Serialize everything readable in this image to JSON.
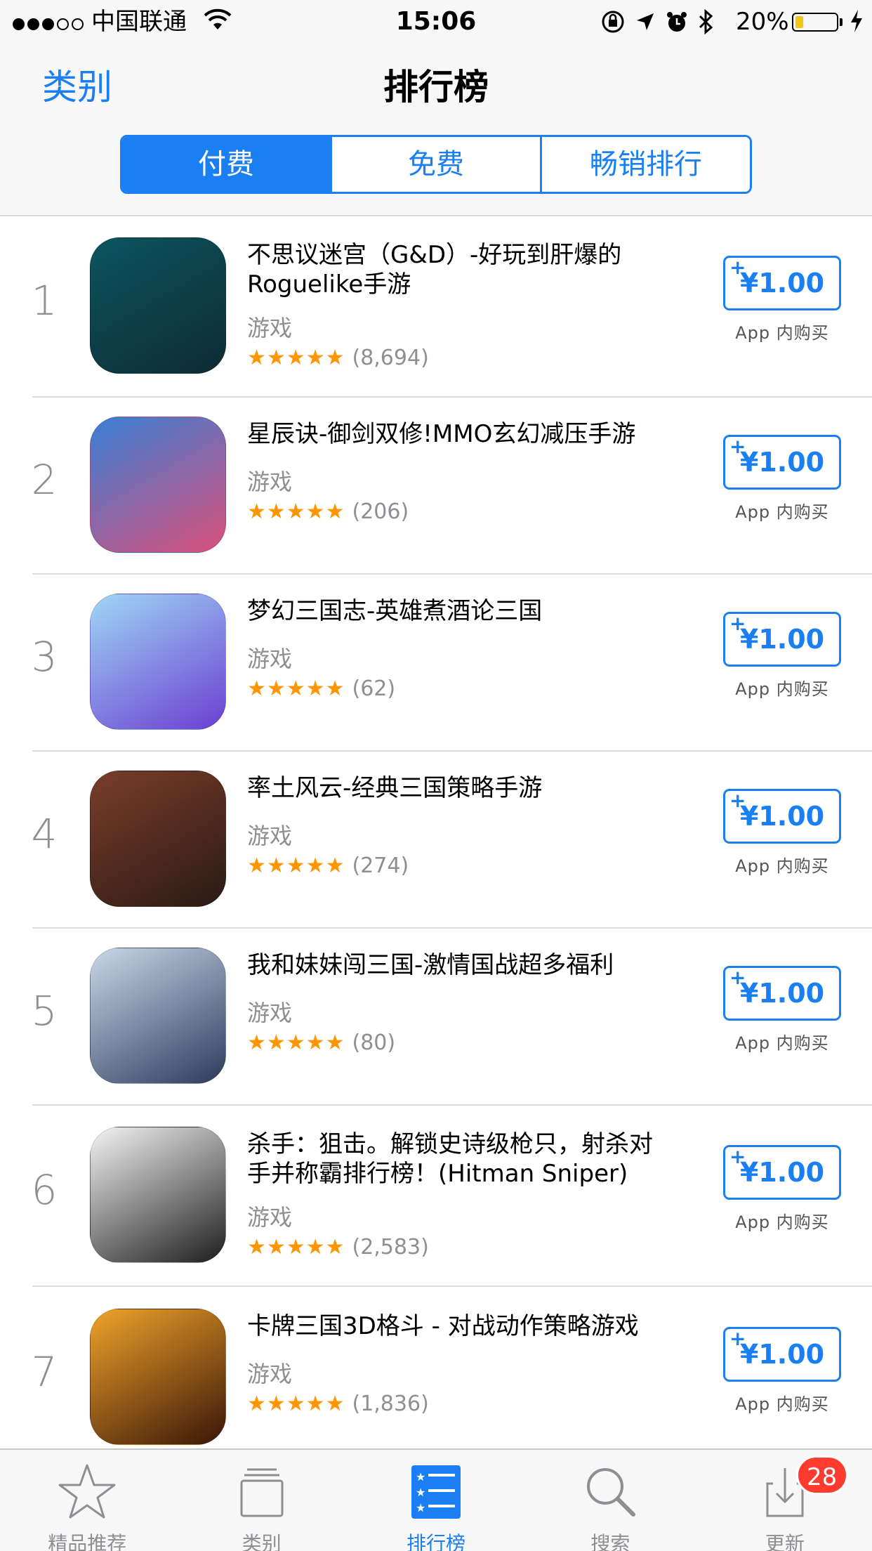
{
  "status_bar": {
    "carrier": "中国联通",
    "time": "15:06",
    "battery_percent_text": "20%",
    "battery_level": 0.2
  },
  "nav": {
    "back_label": "类别",
    "title": "排行榜",
    "segments": [
      "付费",
      "免费",
      "畅销排行"
    ],
    "active_segment": 0
  },
  "apps": [
    {
      "rank": "1",
      "name": "不思议迷宫（G&D）-好玩到肝爆的Roguelike手游",
      "category": "游戏",
      "stars": "★★★★★",
      "reviews": "(8,694)",
      "price": "¥1.00",
      "iap": "App 内购买",
      "icon_colors": [
        "#0c5560",
        "#0e2a33"
      ]
    },
    {
      "rank": "2",
      "name": "星辰诀-御剑双修!MMO玄幻减压手游",
      "category": "游戏",
      "stars": "★★★★★",
      "reviews": "(206)",
      "price": "¥1.00",
      "iap": "App 内购买",
      "icon_colors": [
        "#3a7fd6",
        "#d9507a"
      ]
    },
    {
      "rank": "3",
      "name": "梦幻三国志-英雄煮酒论三国",
      "category": "游戏",
      "stars": "★★★★★",
      "reviews": "(62)",
      "price": "¥1.00",
      "iap": "App 内购买",
      "icon_colors": [
        "#9fd7f5",
        "#6b3fd1"
      ]
    },
    {
      "rank": "4",
      "name": "率土风云-经典三国策略手游",
      "category": "游戏",
      "stars": "★★★★★",
      "reviews": "(274)",
      "price": "¥1.00",
      "iap": "App 内购买",
      "icon_colors": [
        "#7a3d2a",
        "#2a1a14"
      ]
    },
    {
      "rank": "5",
      "name": "我和妹妹闯三国-激情国战超多福利",
      "category": "游戏",
      "stars": "★★★★★",
      "reviews": "(80)",
      "price": "¥1.00",
      "iap": "App 内购买",
      "icon_colors": [
        "#c9d7ea",
        "#2e3b5c"
      ]
    },
    {
      "rank": "6",
      "name": "杀手：狙击。解锁史诗级枪只，射杀对手并称霸排行榜！(Hitman Sniper)",
      "category": "游戏",
      "stars": "★★★★★",
      "reviews": "(2,583)",
      "price": "¥1.00",
      "iap": "App 内购买",
      "icon_colors": [
        "#f4f4f4",
        "#1e1e1e"
      ]
    },
    {
      "rank": "7",
      "name": "卡牌三国3D格斗 - 对战动作策略游戏",
      "category": "游戏",
      "stars": "★★★★★",
      "reviews": "(1,836)",
      "price": "¥1.00",
      "iap": "App 内购买",
      "icon_colors": [
        "#f0a32a",
        "#3a1608"
      ]
    }
  ],
  "tab_bar": {
    "tabs": [
      "精品推荐",
      "类别",
      "排行榜",
      "搜索",
      "更新"
    ],
    "icons": [
      "star-icon",
      "categories-icon",
      "list-icon",
      "search-icon",
      "download-icon"
    ],
    "active_tab": 2,
    "updates_badge": "28"
  },
  "colors": {
    "accent": "#1a7ff2",
    "star": "#ff9500",
    "badge": "#ff3b30"
  }
}
